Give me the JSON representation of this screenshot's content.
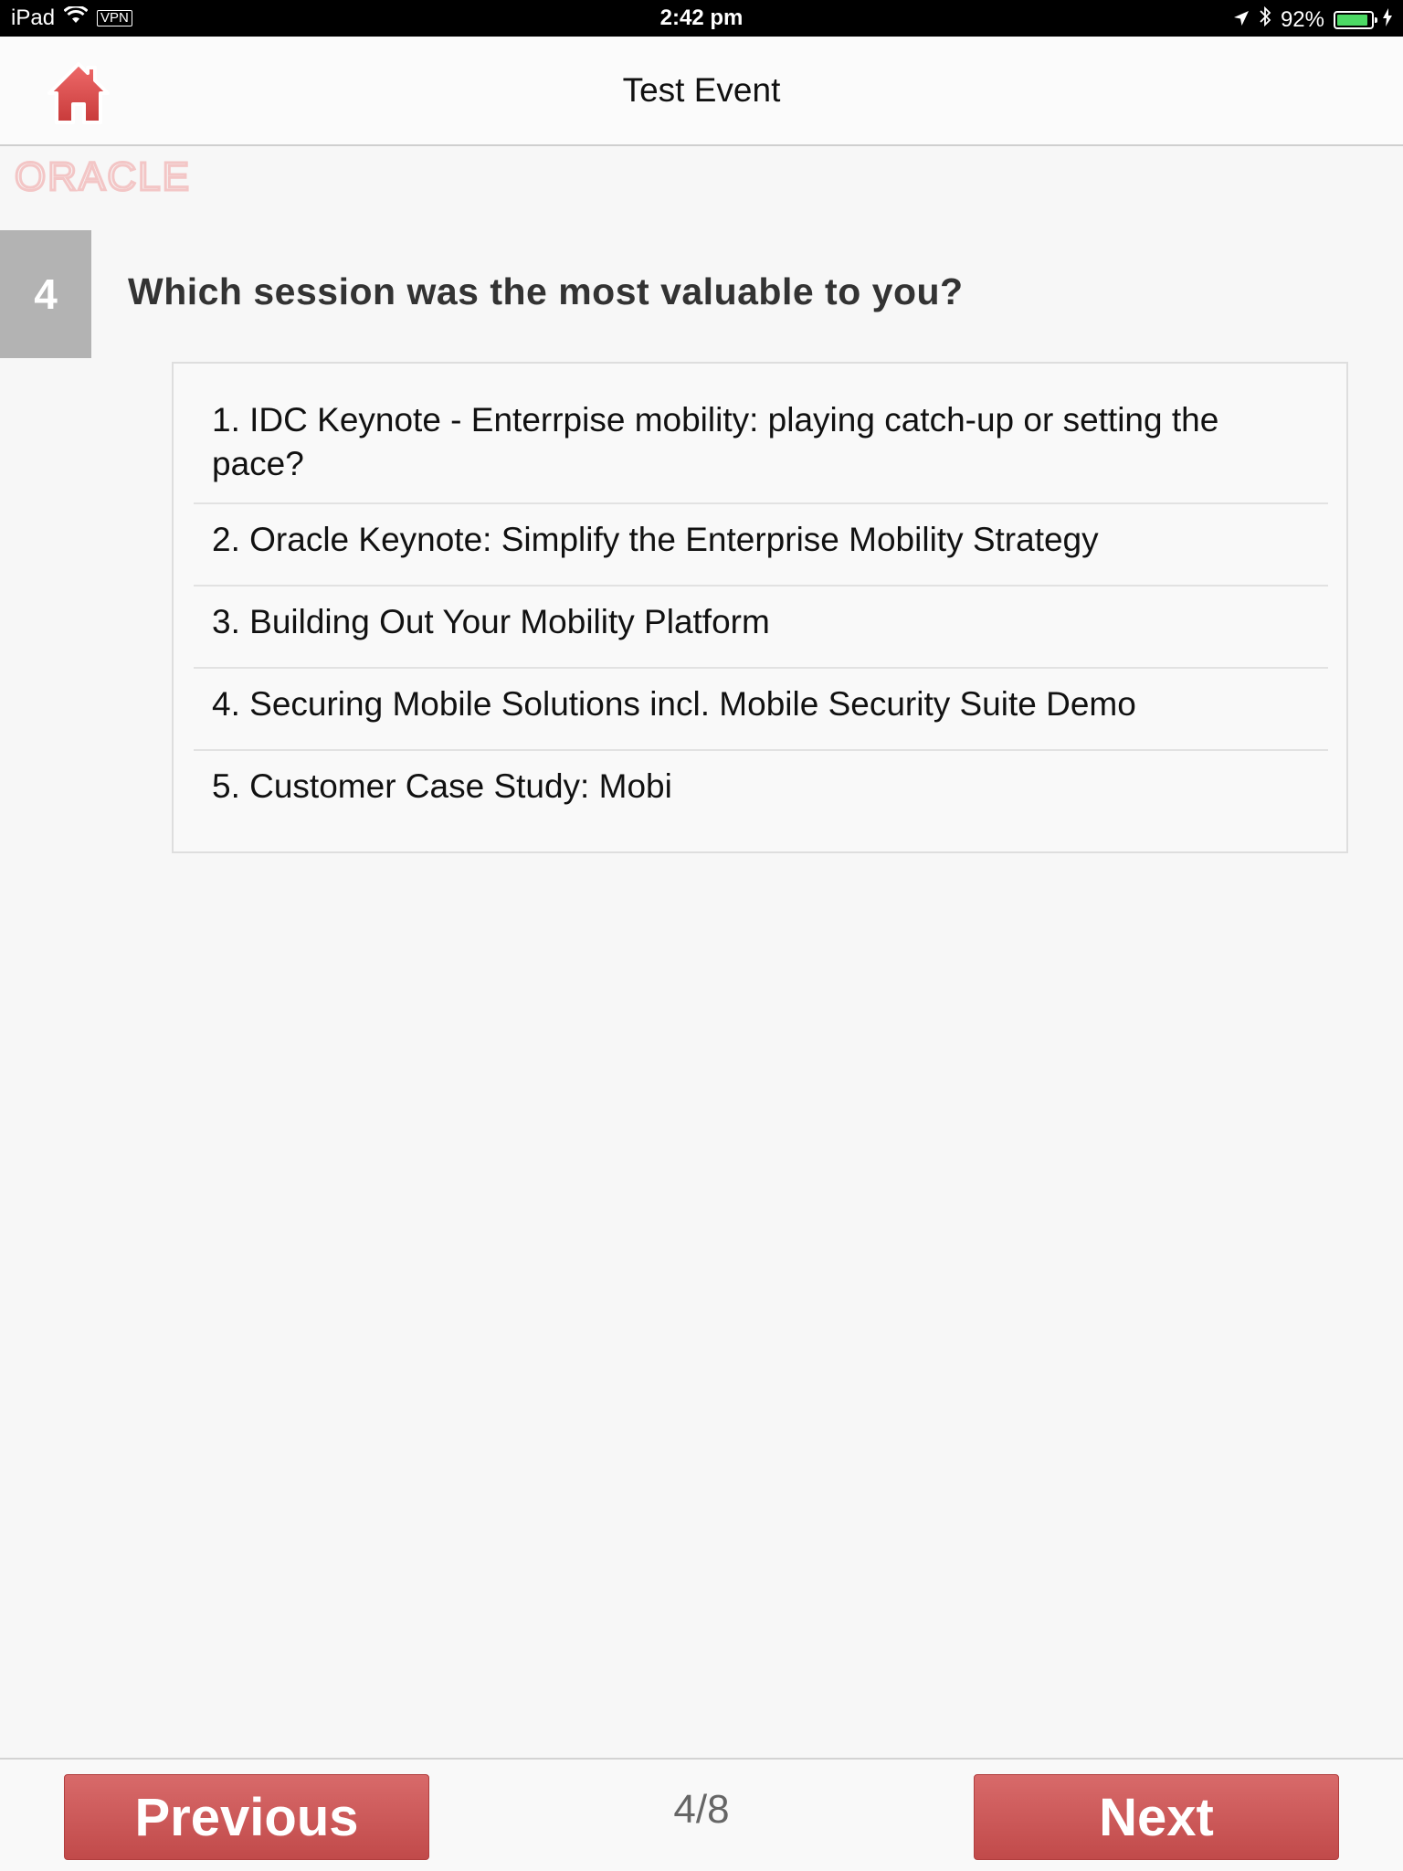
{
  "status_bar": {
    "device": "iPad",
    "vpn": "VPN",
    "time": "2:42 pm",
    "battery_text": "92%",
    "battery_level": 0.92
  },
  "nav": {
    "title": "Test Event",
    "home_icon": "home-icon"
  },
  "logo": {
    "text": "ORACLE",
    "color": "#f3c6c6"
  },
  "question": {
    "number": "4",
    "text": "Which session was the most valuable to you?"
  },
  "options": [
    "1. IDC Keynote - Enterrpise mobility: playing catch-up or setting the pace?",
    "2. Oracle Keynote: Simplify the Enterprise Mobility Strategy",
    "3. Building Out Your Mobility Platform",
    "4. Securing Mobile Solutions incl. Mobile Security Suite Demo",
    "5. Customer Case Study: Mobi"
  ],
  "footer": {
    "previous_label": "Previous",
    "next_label": "Next",
    "page_indicator": "4/8"
  },
  "colors": {
    "accent": "#c94f4f",
    "question_badge": "#b3b3b3"
  }
}
